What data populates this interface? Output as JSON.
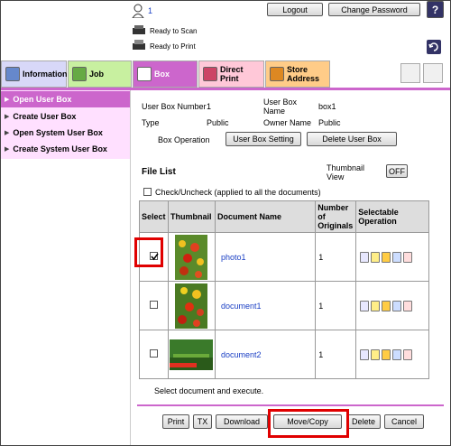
{
  "header": {
    "user_count": "1",
    "logout_label": "Logout",
    "change_password_label": "Change Password",
    "help_label": "?",
    "status_scan": "Ready to Scan",
    "status_print": "Ready to Print"
  },
  "tabs": [
    {
      "label": "Information",
      "color": "#d8d8f8"
    },
    {
      "label": "Job",
      "color": "#c8f0a0"
    },
    {
      "label": "Box",
      "color": "#cc66cc"
    },
    {
      "label": "Direct Print",
      "color": "#ffc8d8"
    },
    {
      "label": "Store Address",
      "color": "#ffcc88"
    }
  ],
  "sidebar": {
    "items": [
      {
        "label": "Open User Box"
      },
      {
        "label": "Create User Box"
      },
      {
        "label": "Open System User Box"
      },
      {
        "label": "Create System User Box"
      }
    ]
  },
  "box_info": {
    "number_label": "User Box Number",
    "number_value": "1",
    "name_label": "User Box Name",
    "name_value": "box1",
    "type_label": "Type",
    "type_value": "Public",
    "owner_label": "Owner Name",
    "owner_value": "Public",
    "operation_label": "Box Operation",
    "setting_button": "User Box Setting",
    "delete_box_button": "Delete User Box"
  },
  "file_list": {
    "title": "File List",
    "thumbnail_view_label": "Thumbnail View",
    "thumbnail_toggle": "OFF",
    "check_all_label": "Check/Uncheck (applied to all the documents)",
    "columns": {
      "select": "Select",
      "thumbnail": "Thumbnail",
      "document_name": "Document Name",
      "originals": "Number of Originals",
      "operation": "Selectable Operation"
    },
    "rows": [
      {
        "name": "photo1",
        "originals": "1",
        "checked": true
      },
      {
        "name": "document1",
        "originals": "1",
        "checked": false
      },
      {
        "name": "document2",
        "originals": "1",
        "checked": false
      }
    ],
    "instruction": "Select document and execute."
  },
  "actions": {
    "print": "Print",
    "tx": "TX",
    "download": "Download",
    "move_copy": "Move/Copy",
    "delete": "Delete",
    "cancel": "Cancel"
  },
  "colors": {
    "menu_bg": "#ffe0ff",
    "menu_active": "#cc66cc",
    "highlight": "#e00000"
  }
}
